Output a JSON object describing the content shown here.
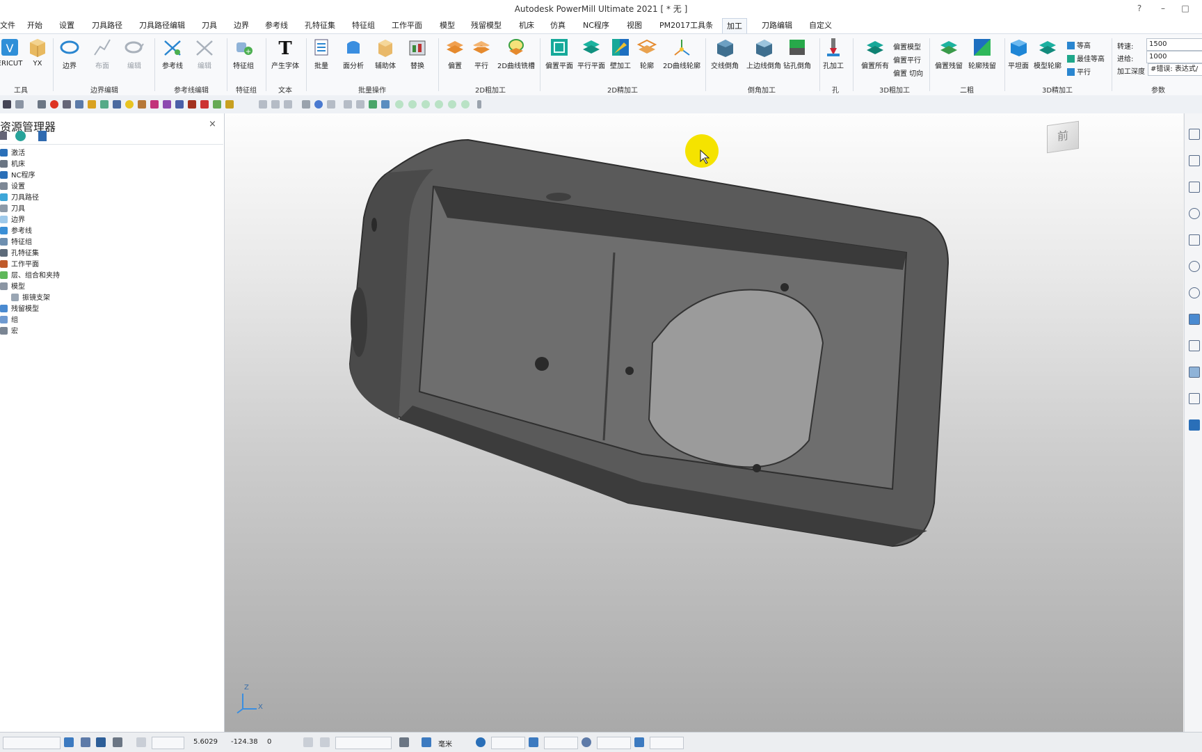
{
  "app": {
    "title": "Autodesk PowerMill Ultimate 2021   [ * 无 ]",
    "help_label": "?",
    "minimize_label": "–",
    "maximize_label": "□"
  },
  "tabs": [
    "文件",
    "开始",
    "设置",
    "刀具路径",
    "刀具路径编辑",
    "刀具",
    "边界",
    "参考线",
    "孔特征集",
    "特征组",
    "工作平面",
    "模型",
    "残留模型",
    "机床",
    "仿真",
    "NC程序",
    "视图",
    "PM2017工具条",
    "加工",
    "刀路编辑",
    "自定义"
  ],
  "active_tab": "加工",
  "ribbon": {
    "groups": [
      {
        "label": "工具",
        "buttons": [
          "ERICUT",
          "YX"
        ]
      },
      {
        "label": "边界编辑",
        "buttons": [
          "边界",
          "布面",
          "编辑"
        ]
      },
      {
        "label": "参考线编辑",
        "buttons": [
          "参考线",
          "编辑"
        ]
      },
      {
        "label": "特征组",
        "buttons": [
          "特征组"
        ]
      },
      {
        "label": "文本",
        "buttons": [
          "产生字体"
        ]
      },
      {
        "label": "批量操作",
        "buttons": [
          "批量",
          "面分析",
          "辅助体",
          "替换"
        ]
      },
      {
        "label": "2D粗加工",
        "buttons": [
          "偏置",
          "平行",
          "2D曲线铣槽"
        ]
      },
      {
        "label": "2D精加工",
        "buttons": [
          "偏置平面",
          "平行平面",
          "壁加工",
          "轮廓",
          "2D曲线轮廓"
        ]
      },
      {
        "label": "倒角加工",
        "buttons": [
          "交线倒角",
          "上边线倒角",
          "钻孔倒角"
        ]
      },
      {
        "label": "孔",
        "buttons": [
          "孔加工"
        ]
      },
      {
        "label": "3D粗加工",
        "buttons": [
          "偏置所有"
        ],
        "small": [
          "偏置模型",
          "偏置平行",
          "偏置 切向"
        ]
      },
      {
        "label": "二粗",
        "buttons": [
          "偏置残留",
          "轮廓残留"
        ]
      },
      {
        "label": "3D精加工",
        "buttons": [
          "平坦面",
          "模型轮廓"
        ],
        "small": [
          "等高",
          "最佳等高",
          "平行"
        ]
      },
      {
        "label": "参数",
        "params": [
          {
            "label": "转速:",
            "value": "1500"
          },
          {
            "label": "进给:",
            "value": "1000"
          },
          {
            "label": "加工深度",
            "value": "#错误: 表达式/"
          }
        ]
      }
    ]
  },
  "explorer": {
    "title": "资源管理器",
    "close_label": "×",
    "items": [
      "激活",
      "机床",
      "NC程序",
      "设置",
      "刀具路径",
      "刀具",
      "边界",
      "参考线",
      "特征组",
      "孔特征集",
      "工作平面",
      "层、组合和夹持",
      "模型",
      "振镜支架",
      "残留模型",
      "组",
      "宏"
    ]
  },
  "viewport": {
    "view_cube_label": "前",
    "axis_z": "Z",
    "axis_x": "X"
  },
  "statusbar": {
    "x_value": "5.6029",
    "y_value": "-124.38",
    "z_value": "0",
    "units": "毫米"
  },
  "colors": {
    "accent": "#1e73be",
    "cursor_highlight": "#f5e300"
  }
}
